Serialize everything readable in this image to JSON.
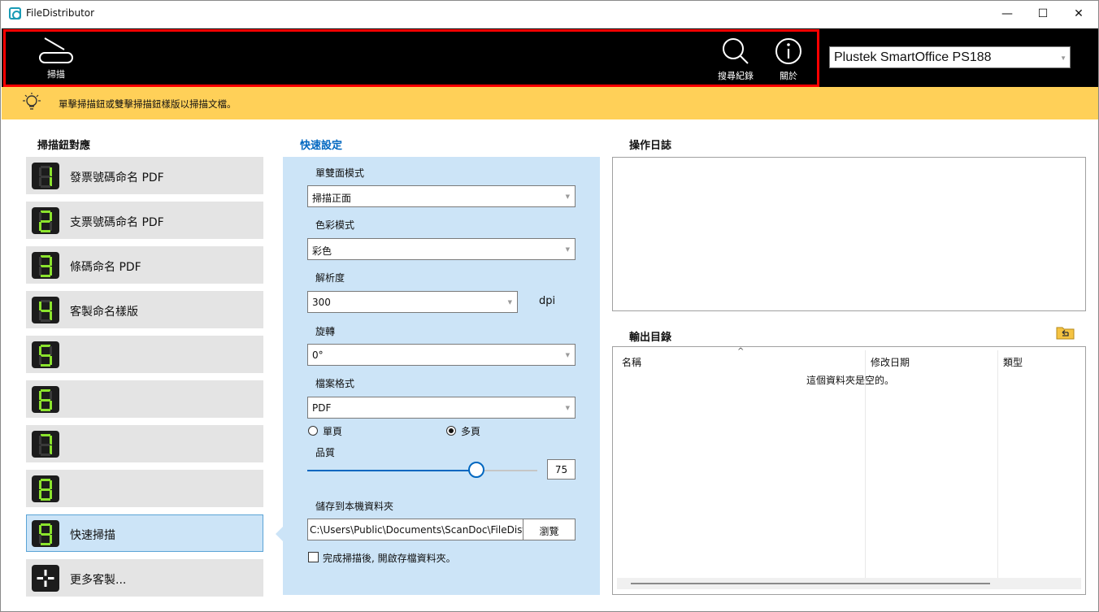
{
  "window": {
    "title": "FileDistributor",
    "controls": {
      "minimize": "—",
      "maximize": "☐",
      "close": "✕"
    }
  },
  "toolbar": {
    "scan_label": "掃描",
    "search_history_label": "搜尋紀錄",
    "about_label": "關於",
    "device": "Plustek SmartOffice PS188"
  },
  "hint": {
    "text": "單擊掃描鈕或雙擊掃描鈕樣版以掃描文檔。"
  },
  "button_map": {
    "title": "掃描鈕對應",
    "items": [
      {
        "digit": "1",
        "label": "發票號碼命名 PDF"
      },
      {
        "digit": "2",
        "label": "支票號碼命名 PDF"
      },
      {
        "digit": "3",
        "label": "條碼命名 PDF"
      },
      {
        "digit": "4",
        "label": "客製命名樣版"
      },
      {
        "digit": "5",
        "label": ""
      },
      {
        "digit": "6",
        "label": ""
      },
      {
        "digit": "7",
        "label": ""
      },
      {
        "digit": "8",
        "label": ""
      },
      {
        "digit": "9",
        "label": "快速掃描",
        "selected": true
      }
    ],
    "more_label": "更多客製..."
  },
  "quick_settings": {
    "title": "快速設定",
    "duplex_label": "單雙面模式",
    "duplex_value": "掃描正面",
    "color_label": "色彩模式",
    "color_value": "彩色",
    "resolution_label": "解析度",
    "resolution_value": "300",
    "resolution_unit": "dpi",
    "rotation_label": "旋轉",
    "rotation_value": "0°",
    "format_label": "檔案格式",
    "format_value": "PDF",
    "single_page_label": "單頁",
    "multi_page_label": "多頁",
    "page_mode_selected": "多頁",
    "quality_label": "品質",
    "quality_value": "75",
    "save_label": "儲存到本機資料夾",
    "save_path": "C:\\Users\\Public\\Documents\\ScanDoc\\FileDistributor",
    "browse_label": "瀏覽",
    "open_after_label": "完成掃描後, 開啟存檔資料夾。",
    "open_after_checked": false
  },
  "log": {
    "title": "操作日誌"
  },
  "output": {
    "title": "輸出目錄",
    "columns": [
      "名稱",
      "修改日期",
      "類型"
    ],
    "empty_message": "這個資料夾是空的。"
  },
  "colors": {
    "toolbar_bg": "#000000",
    "hint_bg": "#ffd058",
    "accent": "#0067c0",
    "panel_bg": "#cce4f7",
    "digit_color": "#8be32d",
    "highlight_border": "#ff0000"
  }
}
